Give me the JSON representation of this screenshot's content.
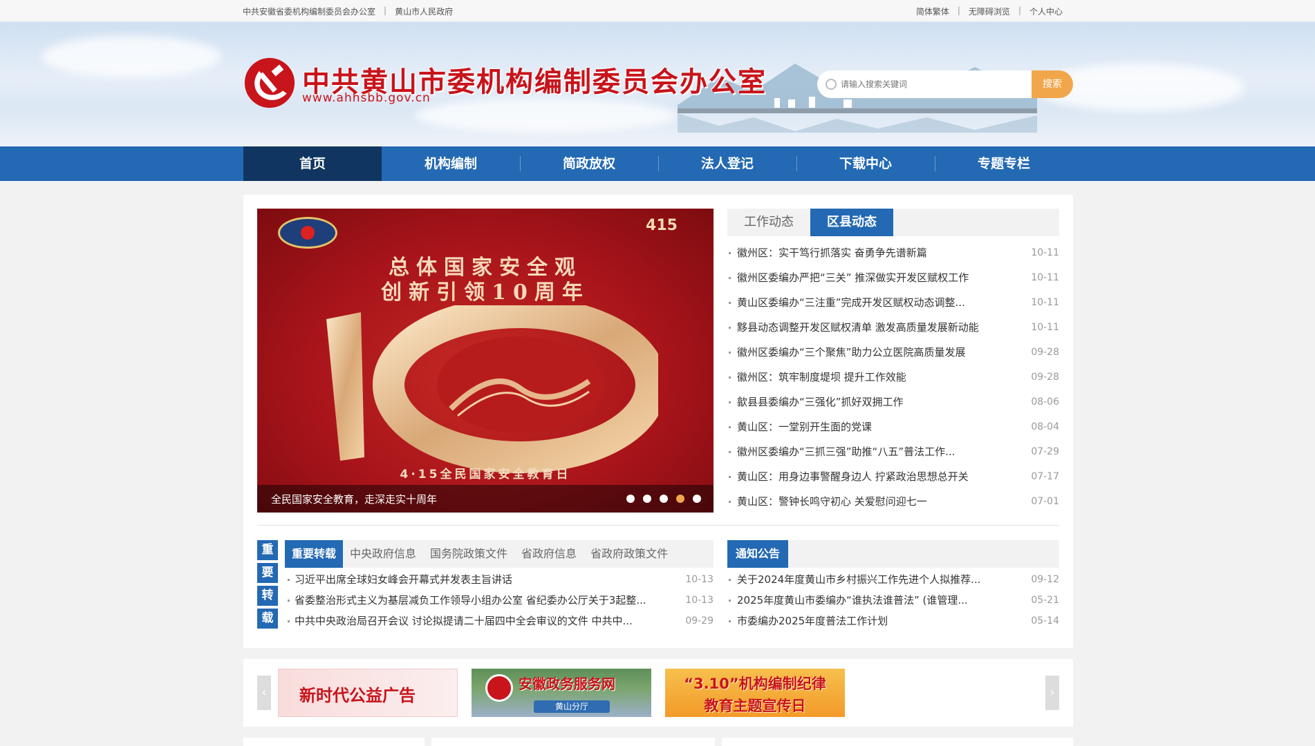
{
  "topbar": {
    "left_links": [
      "中共安徽省委机构编制委员会办公室",
      "黄山市人民政府"
    ],
    "right_links": [
      "简体繁体",
      "无障碍浏览",
      "个人中心"
    ],
    "separator": "|"
  },
  "header": {
    "title": "中共黄山市委机构编制委员会办公室",
    "url": "www.ahhsbb.gov.cn",
    "search_placeholder": "请输入搜索关键词",
    "search_button": "搜索"
  },
  "nav": {
    "items": [
      "首页",
      "机构编制",
      "简政放权",
      "法人登记",
      "下载中心",
      "专题专栏"
    ],
    "active_index": 0
  },
  "carousel": {
    "headline_1": "总体国家安全观",
    "headline_2": "创新引领10周年",
    "logo_text": "415",
    "footer_text": "4·15全民国家安全教育日",
    "caption": "全民国家安全教育，走深走实十周年",
    "dots": 5,
    "active_dot": 3
  },
  "news": {
    "tabs": [
      "工作动态",
      "区县动态"
    ],
    "active_tab": 1,
    "items": [
      {
        "title": "徽州区：实干笃行抓落实 奋勇争先谱新篇",
        "date": "10-11"
      },
      {
        "title": "徽州区委编办严把“三关” 推深做实开发区赋权工作",
        "date": "10-11"
      },
      {
        "title": "黄山区委编办“三注重”完成开发区赋权动态调整...",
        "date": "10-11"
      },
      {
        "title": "黟县动态调整开发区赋权清单 激发高质量发展新动能",
        "date": "10-11"
      },
      {
        "title": "徽州区委编办“三个聚焦”助力公立医院高质量发展",
        "date": "09-28"
      },
      {
        "title": "徽州区：筑牢制度堤坝 提升工作效能",
        "date": "09-28"
      },
      {
        "title": "歙县县委编办“三强化”抓好双拥工作",
        "date": "08-06"
      },
      {
        "title": "黄山区：一堂别开生面的党课",
        "date": "08-04"
      },
      {
        "title": "徽州区委编办“三抓三强”助推“八五”普法工作...",
        "date": "07-29"
      },
      {
        "title": "黄山区：用身边事警醒身边人 拧紧政治思想总开关",
        "date": "07-17"
      },
      {
        "title": "黄山区：警钟长鸣守初心 关爱慰问迎七一",
        "date": "07-01"
      }
    ]
  },
  "important": {
    "vertical_label": [
      "重",
      "要",
      "转",
      "载"
    ],
    "tabs": [
      "重要转载",
      "中央政府信息",
      "国务院政策文件",
      "省政府信息",
      "省政府政策文件"
    ],
    "active_tab": 0,
    "items": [
      {
        "title": "习近平出席全球妇女峰会开幕式并发表主旨讲话",
        "date": "10-13"
      },
      {
        "title": "省委整治形式主义为基层减负工作领导小组办公室 省纪委办公厅关于3起整...",
        "date": "10-13"
      },
      {
        "title": "中共中央政治局召开会议 讨论拟提请二十届四中全会审议的文件 中共中...",
        "date": "09-29"
      }
    ]
  },
  "notice": {
    "tab": "通知公告",
    "items": [
      {
        "title": "关于2024年度黄山市乡村振兴工作先进个人拟推荐...",
        "date": "09-12"
      },
      {
        "title": "2025年度黄山市委编办“谁执法谁普法” (谁管理...",
        "date": "05-21"
      },
      {
        "title": "市委编办2025年度普法工作计划",
        "date": "05-14"
      }
    ]
  },
  "links": {
    "prev": "‹",
    "next": "›",
    "ad1": "新时代公益广告",
    "ad2_title": "安徽政务服务网",
    "ad2_sub": "黄山分厅",
    "ad3_line1": "“3.10”机构编制纪律",
    "ad3_line2": "教育主题宣传日"
  },
  "colors": {
    "brand_blue": "#2369b3",
    "nav_active": "#0f3560",
    "title_red": "#c8141b",
    "search_orange": "#f2a64b"
  }
}
